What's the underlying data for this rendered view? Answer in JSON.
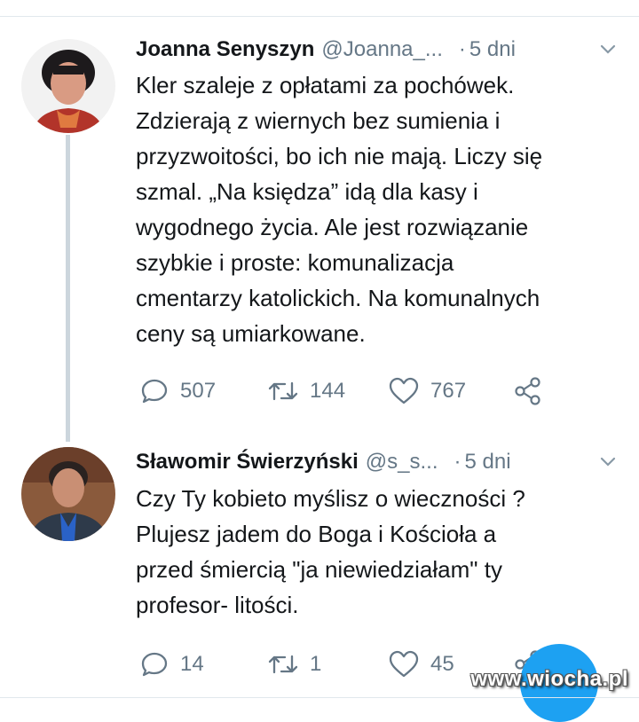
{
  "tweets": [
    {
      "name": "Joanna Senyszyn",
      "handle": "@Joanna_...",
      "dot": "·",
      "time": "5 dni",
      "text": "Kler szaleje z opłatami za pochówek.\nZdzierają z wiernych bez sumienia i\nprzyzwoitości, bo ich nie mają. Liczy się\nszmal. „Na księdza” idą dla kasy i\nwygodnego życia. Ale jest rozwiązanie\nszybkie i proste: komunalizacja\ncmentarzy katolickich. Na komunalnych\nceny są umiarkowane.",
      "replies": "507",
      "retweets": "144",
      "likes": "767"
    },
    {
      "name": "Sławomir Świerzyński",
      "handle": "@s_s...",
      "dot": "·",
      "time": "5 dni",
      "text": "Czy Ty kobieto myślisz o wieczności ?\nPlujesz jadem do Boga i  Kościoła a\nprzed śmiercią \"ja niewiedziałam\" ty\nprofesor- litości.",
      "replies": "14",
      "retweets": "1",
      "likes": "45"
    }
  ],
  "watermark": "www.wiocha.pl",
  "icons": {
    "reply": "reply-icon",
    "retweet": "retweet-icon",
    "like": "heart-icon",
    "share": "share-icon",
    "more": "chevron-down-icon",
    "compose": "compose-fab-icon"
  },
  "colors": {
    "text": "#14171a",
    "secondary": "#657786",
    "thread_line": "#ccd6dd",
    "accent": "#1da1f2"
  }
}
